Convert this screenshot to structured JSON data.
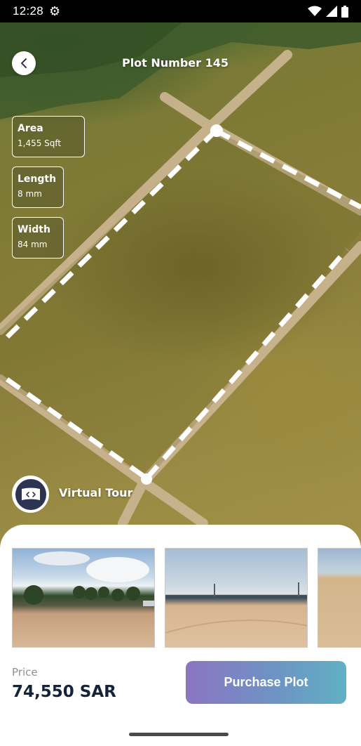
{
  "status_bar": {
    "time": "12:28"
  },
  "header": {
    "title": "Plot Number 145"
  },
  "measurements": {
    "area": {
      "label": "Area",
      "value": "1,455 Sqft"
    },
    "length": {
      "label": "Length",
      "value": "8 mm"
    },
    "width": {
      "label": "Width",
      "value": "84 mm"
    }
  },
  "virtual_tour": {
    "label": "Virtual Tour"
  },
  "price": {
    "label": "Price",
    "value": "74,550 SAR"
  },
  "actions": {
    "purchase_label": "Purchase Plot"
  },
  "colors": {
    "primary_dark": "#2c3452",
    "price_text": "#15233a",
    "button_gradient_start": "#8b75c2",
    "button_gradient_end": "#60b0c4"
  },
  "icons": [
    "settings-gear-icon",
    "wifi-icon",
    "cellular-signal-icon",
    "battery-icon",
    "chevron-left-icon",
    "vr-headset-icon"
  ]
}
